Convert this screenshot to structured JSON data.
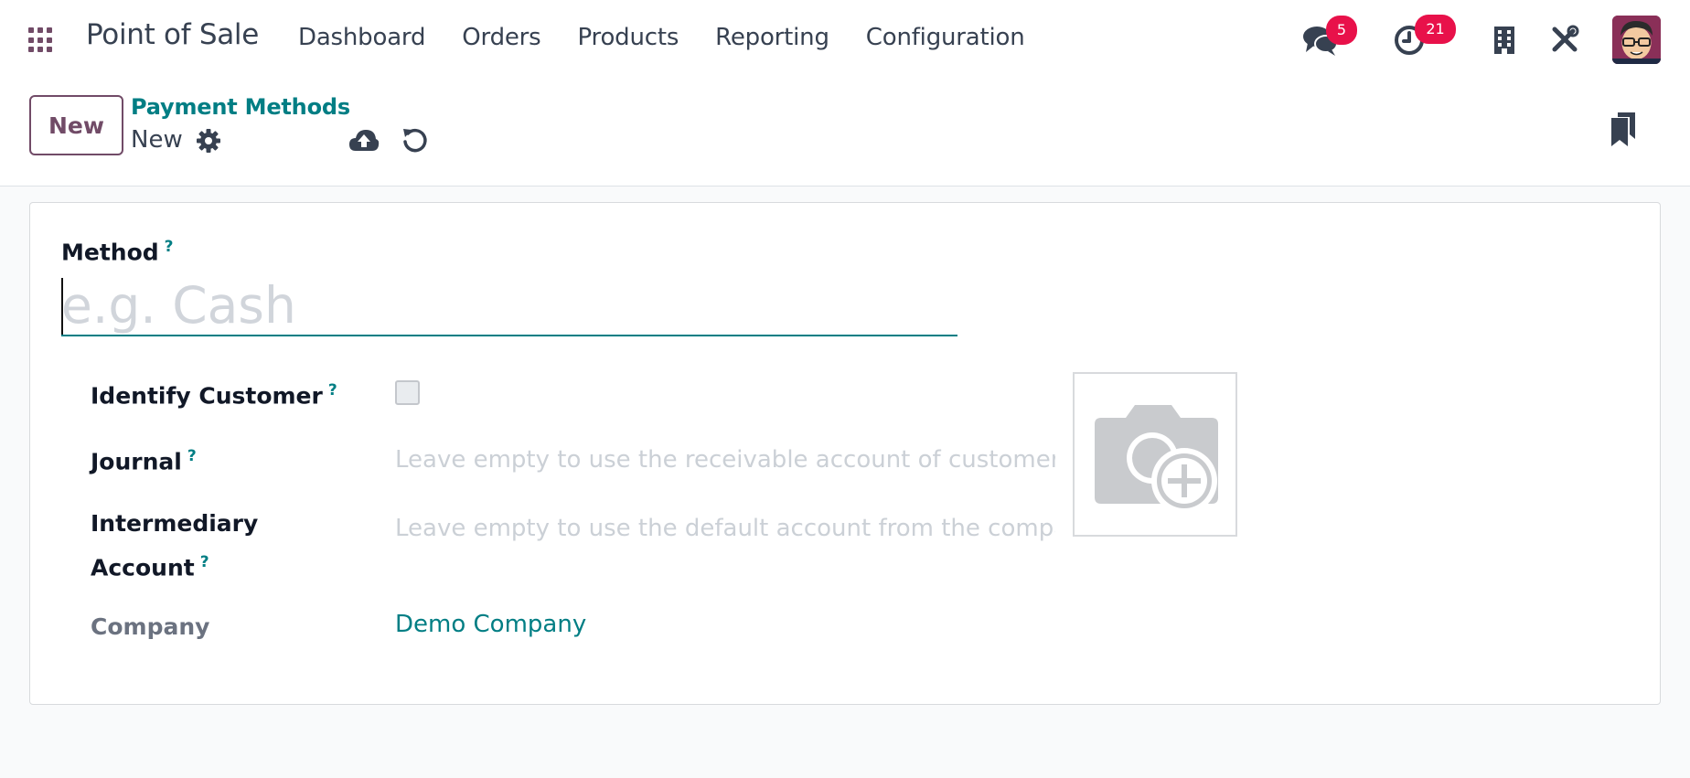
{
  "navbar": {
    "app_name": "Point of Sale",
    "menu": [
      "Dashboard",
      "Orders",
      "Products",
      "Reporting",
      "Configuration"
    ],
    "messages_badge": "5",
    "activities_badge": "21"
  },
  "control_panel": {
    "new_button": "New",
    "breadcrumb": "Payment Methods",
    "record_name": "New"
  },
  "form": {
    "method_label": "Method",
    "method_placeholder": "e.g. Cash",
    "help_mark": "?",
    "identify_customer_label": "Identify Customer",
    "identify_customer_checked": false,
    "journal_label": "Journal",
    "journal_placeholder": "Leave empty to use the receivable account of customer",
    "intermediary_label_line1": "Intermediary",
    "intermediary_label_line2": "Account",
    "intermediary_placeholder": "Leave empty to use the default account from the company setting",
    "company_label": "Company",
    "company_value": "Demo Company"
  },
  "colors": {
    "brand": "#714b67",
    "accent": "#017e84",
    "badge": "#e8114a"
  }
}
